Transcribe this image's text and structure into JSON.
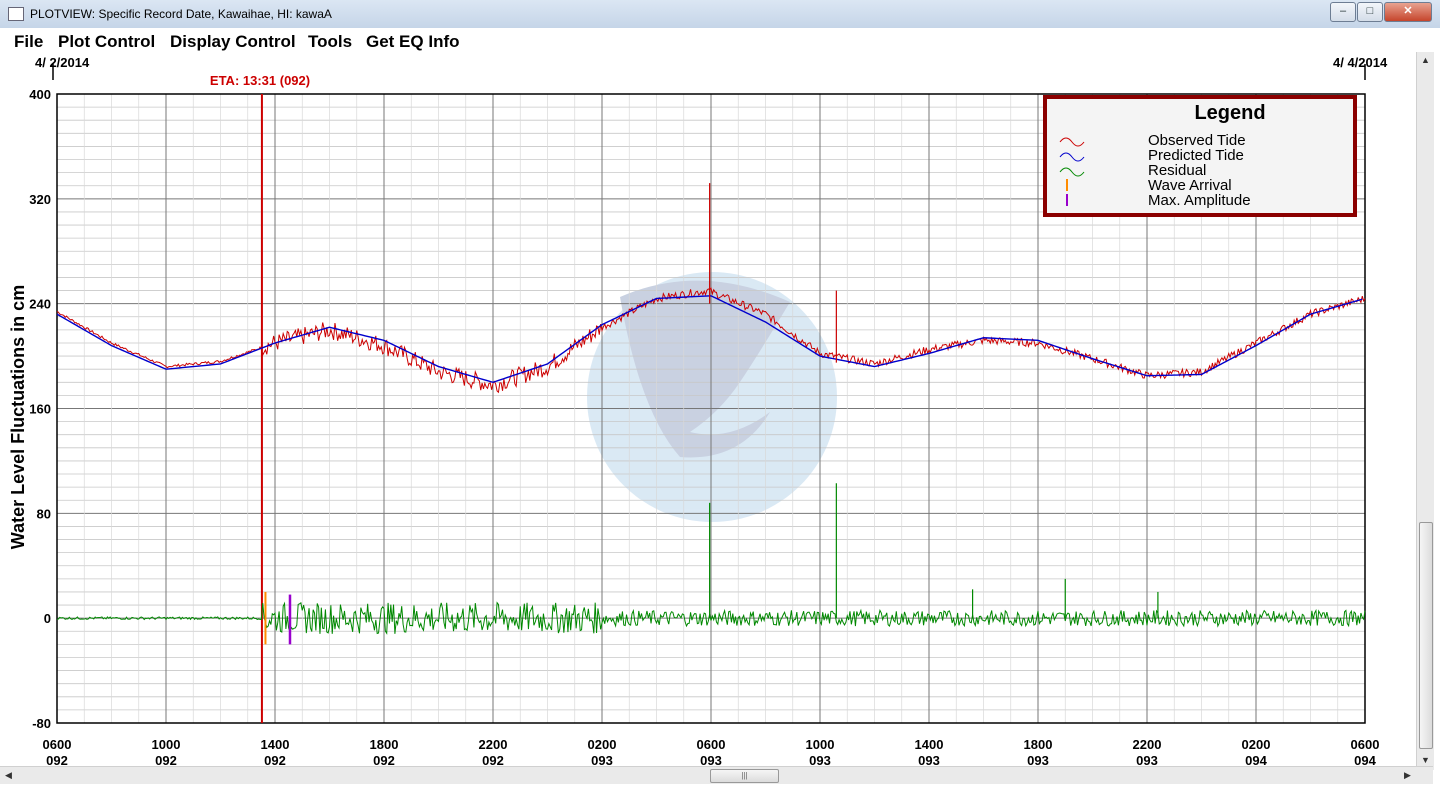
{
  "window": {
    "title": "PLOTVIEW: Specific Record Date, Kawaihae, HI: kawaA",
    "minimize_label": "–",
    "maximize_label": "□",
    "close_label": "✕"
  },
  "menu": {
    "items": [
      {
        "label": "File"
      },
      {
        "label": "Plot Control"
      },
      {
        "label": "Display Control"
      },
      {
        "label": "Tools"
      },
      {
        "label": "Get EQ Info"
      }
    ]
  },
  "plot": {
    "start_date": "4/ 2/2014",
    "end_date": "4/ 4/2014",
    "eta_label": "ETA: 13:31 (092)",
    "eta_hours": 7.52,
    "wave_arrival_hours": 7.65,
    "max_amplitude_hours": 8.55,
    "y_axis_label": "Water Level Fluctuations in cm",
    "ylim": [
      -80,
      400
    ],
    "y_ticks": [
      400,
      320,
      240,
      160,
      80,
      0,
      -80
    ],
    "x_ticks": [
      {
        "time": "0600",
        "day": "092"
      },
      {
        "time": "1000",
        "day": "092"
      },
      {
        "time": "1400",
        "day": "092"
      },
      {
        "time": "1800",
        "day": "092"
      },
      {
        "time": "2200",
        "day": "092"
      },
      {
        "time": "0200",
        "day": "093"
      },
      {
        "time": "0600",
        "day": "093"
      },
      {
        "time": "1000",
        "day": "093"
      },
      {
        "time": "1400",
        "day": "093"
      },
      {
        "time": "1800",
        "day": "093"
      },
      {
        "time": "2200",
        "day": "093"
      },
      {
        "time": "0200",
        "day": "094"
      },
      {
        "time": "0600",
        "day": "094"
      }
    ],
    "legend": {
      "title": "Legend",
      "items": [
        {
          "label": "Observed Tide",
          "color": "#cc0000"
        },
        {
          "label": "Predicted Tide",
          "color": "#0000cc"
        },
        {
          "label": "Residual",
          "color": "#008800"
        },
        {
          "label": "Wave Arrival",
          "color": "#ff8c00"
        },
        {
          "label": "Max. Amplitude",
          "color": "#9900cc"
        }
      ]
    },
    "colors": {
      "observed": "#cc0000",
      "predicted": "#0000cc",
      "residual": "#008800",
      "eta_line": "#cc0000",
      "wave_arrival": "#ff8c00",
      "max_amplitude": "#9900cc",
      "legend_border": "#8b0000"
    }
  },
  "chart_data": {
    "type": "line",
    "x_unit": "hours after 0600 (092)",
    "ylabel": "Water Level Fluctuations in cm",
    "ylim": [
      -80,
      400
    ],
    "xlim": [
      0,
      48
    ],
    "series": [
      {
        "name": "Observed Tide",
        "color": "#cc0000",
        "x": [
          0,
          2,
          4,
          6,
          8,
          10,
          12,
          14,
          16,
          18,
          20,
          22,
          23.9,
          26,
          28,
          30,
          32,
          34,
          36,
          38,
          40,
          42,
          44,
          46,
          48
        ],
        "values": [
          234,
          210,
          192,
          196,
          210,
          220,
          208,
          188,
          178,
          192,
          222,
          244,
          250,
          232,
          202,
          194,
          205,
          212,
          210,
          198,
          185,
          188,
          210,
          232,
          244
        ]
      },
      {
        "name": "Predicted Tide",
        "color": "#0000cc",
        "x": [
          0,
          2,
          4,
          6,
          8,
          10,
          12,
          14,
          16,
          18,
          20,
          22,
          24,
          26,
          28,
          30,
          32,
          34,
          36,
          38,
          40,
          42,
          44,
          46,
          48
        ],
        "values": [
          232,
          208,
          190,
          194,
          210,
          222,
          212,
          192,
          180,
          194,
          224,
          244,
          246,
          226,
          200,
          192,
          202,
          214,
          212,
          198,
          185,
          186,
          208,
          232,
          244
        ]
      },
      {
        "name": "Residual",
        "color": "#008800",
        "x": [
          0,
          7.5,
          8,
          9,
          12,
          16,
          20,
          24,
          23.9,
          28.6,
          32,
          36,
          37.3,
          40.6,
          42.5,
          48
        ],
        "values": [
          0,
          0,
          18,
          12,
          10,
          12,
          10,
          8,
          88,
          103,
          6,
          20,
          30,
          22,
          18,
          0
        ]
      }
    ]
  }
}
